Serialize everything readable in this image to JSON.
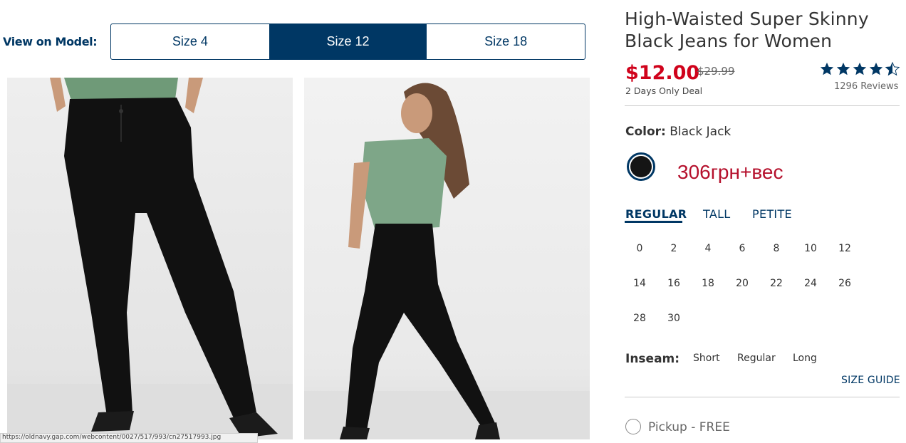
{
  "view_on_model": {
    "label": "View on Model:",
    "sizes": [
      "Size 4",
      "Size 12",
      "Size 18"
    ],
    "selected": "Size 12"
  },
  "product": {
    "title_line1": "High-Waisted Super Skinny",
    "title_line2": "Black Jeans for Women",
    "price": "$12.00",
    "original_price": "$29.99",
    "deal_text": "2 Days Only Deal",
    "reviews": "1296 Reviews",
    "rating_stars": 4.5
  },
  "color": {
    "label": "Color:",
    "value": "Black Jack",
    "swatch_hex": "#151515"
  },
  "overlay_note": "306грн+вес",
  "fit_tabs": [
    "REGULAR",
    "TALL",
    "PETITE"
  ],
  "fit_selected": "REGULAR",
  "sizes": [
    [
      "0",
      "2",
      "4",
      "6",
      "8",
      "10",
      "12"
    ],
    [
      "14",
      "16",
      "18",
      "20",
      "22",
      "24",
      "26"
    ],
    [
      "28",
      "30"
    ]
  ],
  "inseam": {
    "label": "Inseam:",
    "options": [
      "Short",
      "Regular",
      "Long"
    ]
  },
  "size_guide": "SIZE GUIDE",
  "pickup": "Pickup - FREE",
  "status_url": "https://oldnavy.gap.com/webcontent/0027/517/993/cn27517993.jpg",
  "colors": {
    "brand_navy": "#003764",
    "sale_red": "#d0021b",
    "note_red": "#b5102c"
  }
}
